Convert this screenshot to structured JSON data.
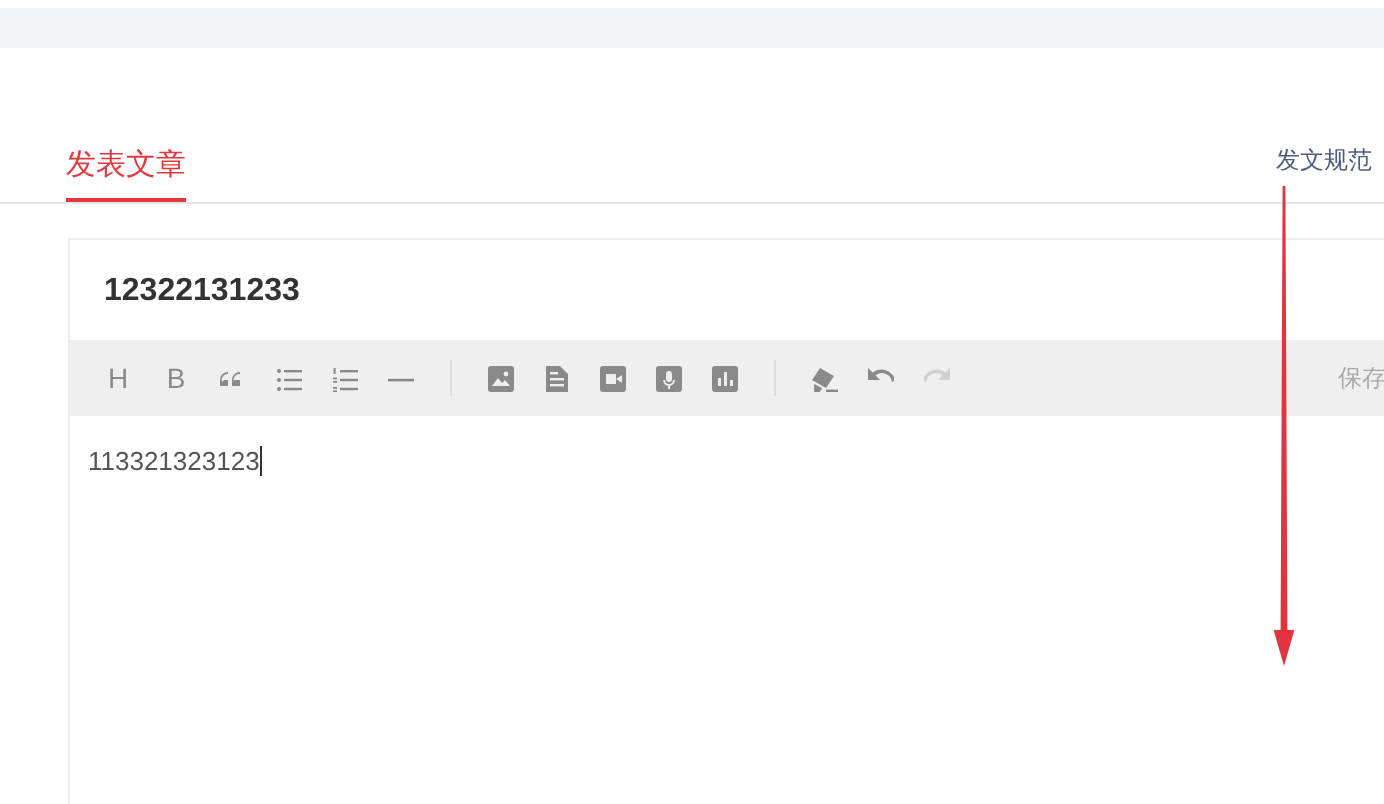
{
  "tabs": [
    {
      "label": "发表文章",
      "selected": true
    }
  ],
  "guidelines_link": "发文规范",
  "editor": {
    "title": "12322131233",
    "toolbar": [
      {
        "items": [
          {
            "kind": "text",
            "label": "H",
            "disabled": false
          },
          {
            "kind": "text",
            "label": "B",
            "disabled": false
          },
          {
            "kind": "quote",
            "disabled": false
          },
          {
            "kind": "bullet-list",
            "disabled": false
          },
          {
            "kind": "numbered-list",
            "disabled": false
          },
          {
            "kind": "rule",
            "disabled": false
          }
        ]
      },
      {
        "items": [
          {
            "kind": "image",
            "disabled": false
          },
          {
            "kind": "document",
            "disabled": false
          },
          {
            "kind": "video",
            "disabled": false
          },
          {
            "kind": "audio",
            "disabled": false
          },
          {
            "kind": "chart",
            "disabled": false
          }
        ]
      },
      {
        "items": [
          {
            "kind": "eraser",
            "disabled": false
          },
          {
            "kind": "undo",
            "disabled": false
          },
          {
            "kind": "redo",
            "disabled": true
          }
        ]
      }
    ],
    "save_label": "保存",
    "body": "113321323123",
    "caret": true
  },
  "annotation": {
    "kind": "arrow"
  }
}
